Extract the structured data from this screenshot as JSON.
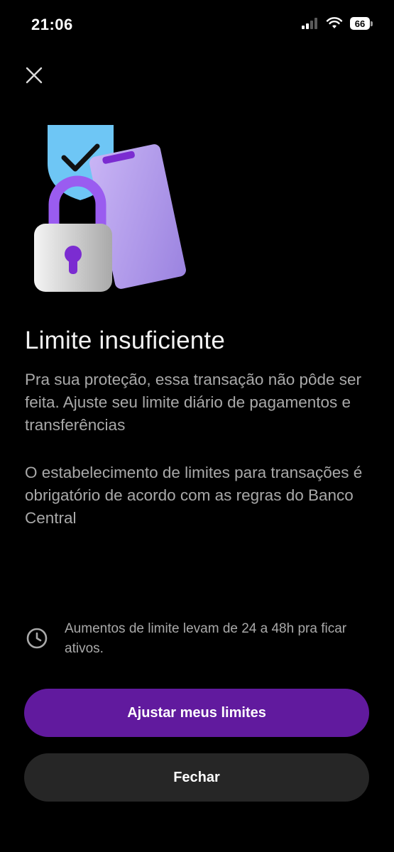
{
  "status_bar": {
    "time": "21:06",
    "battery_level": "66",
    "icons": [
      "signal-icon",
      "wifi-icon",
      "battery-icon"
    ]
  },
  "header": {
    "close_icon": "close-icon"
  },
  "illustration": {
    "icons": [
      "shield-check-icon",
      "padlock-icon",
      "phone-icon"
    ]
  },
  "content": {
    "title": "Limite insuficiente",
    "paragraph1": "Pra sua proteção, essa transação não pôde ser feita. Ajuste seu limite diário de pagamentos e transferências",
    "paragraph2": "O estabelecimento de limites para transações é obrigatório de acordo com as regras do Banco Central",
    "notice": "Aumentos de limite levam de 24 a 48h pra ficar ativos.",
    "notice_icon": "clock-icon"
  },
  "actions": {
    "primary_label": "Ajustar meus limites",
    "secondary_label": "Fechar"
  },
  "colors": {
    "background": "#000000",
    "primary_button": "#611a9e",
    "secondary_button": "#262626",
    "body_text": "#a9a9a9"
  }
}
